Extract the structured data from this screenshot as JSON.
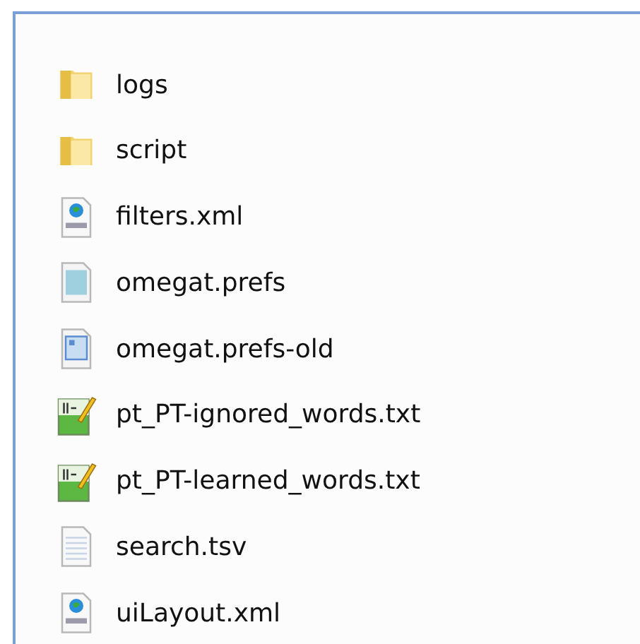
{
  "files": [
    {
      "name": "logs",
      "kind": "folder"
    },
    {
      "name": "script",
      "kind": "folder"
    },
    {
      "name": "filters.xml",
      "kind": "xml"
    },
    {
      "name": "omegat.prefs",
      "kind": "prefs"
    },
    {
      "name": "omegat.prefs-old",
      "kind": "image"
    },
    {
      "name": "pt_PT-ignored_words.txt",
      "kind": "notepad"
    },
    {
      "name": "pt_PT-learned_words.txt",
      "kind": "notepad"
    },
    {
      "name": "search.tsv",
      "kind": "text"
    },
    {
      "name": "uiLayout.xml",
      "kind": "xml"
    }
  ]
}
